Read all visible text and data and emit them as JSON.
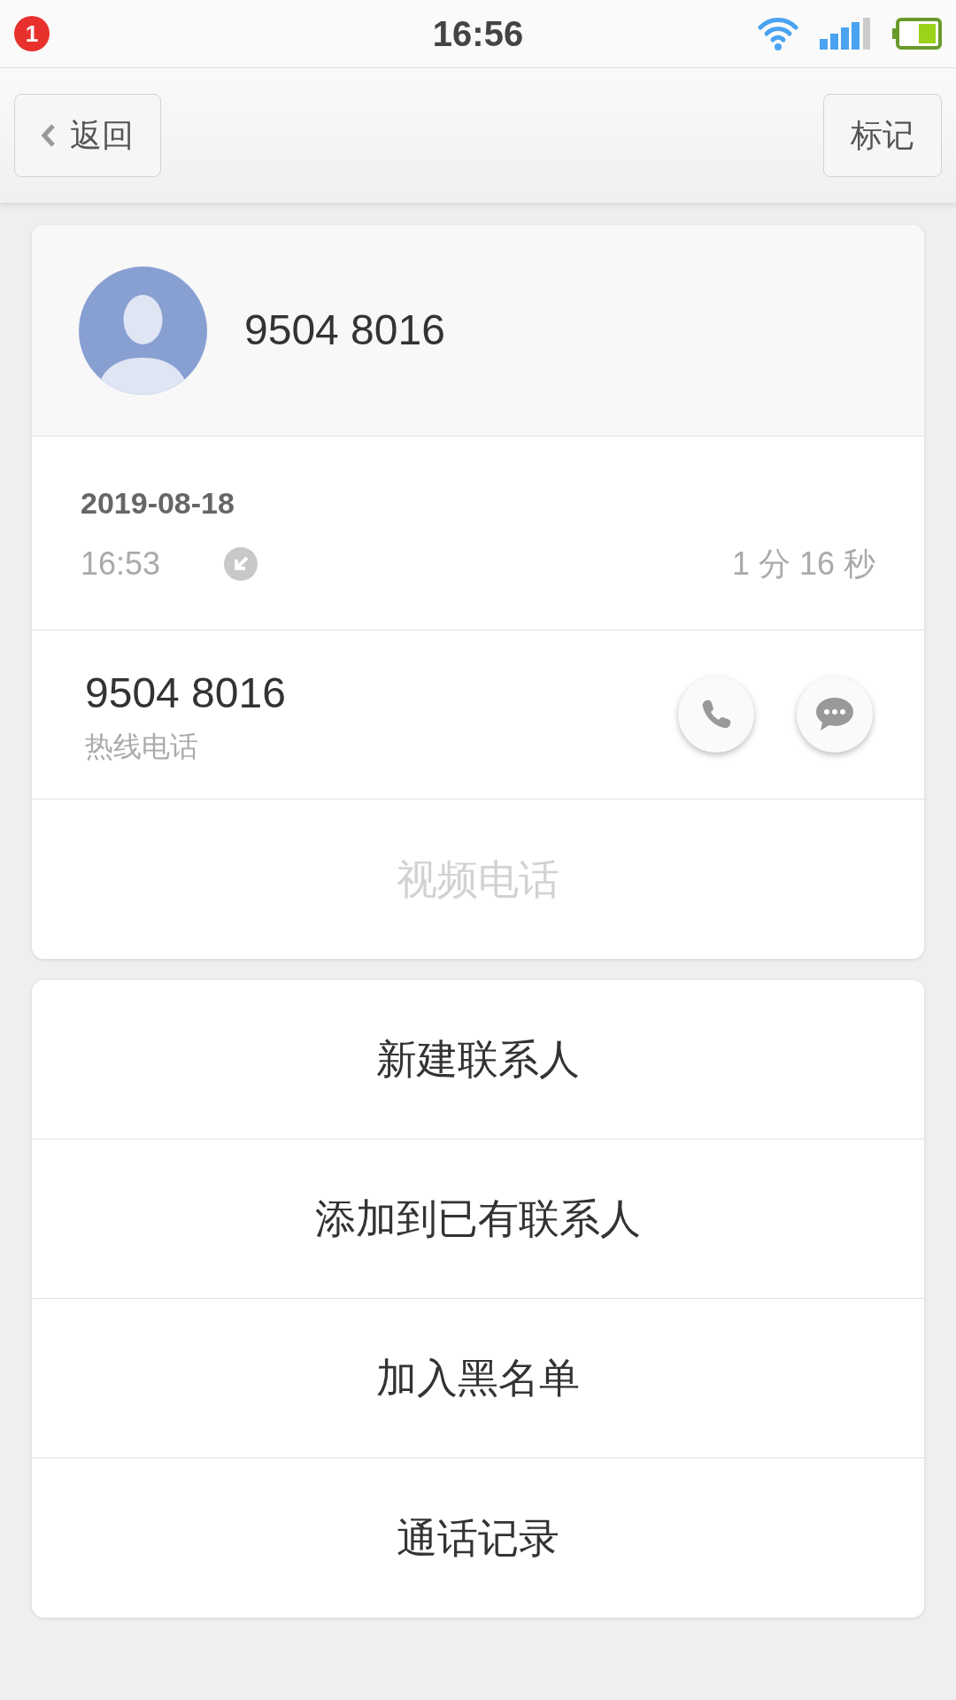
{
  "status_bar": {
    "notification_count": "1",
    "time": "16:56"
  },
  "nav": {
    "back": "返回",
    "mark": "标记"
  },
  "contact": {
    "name": "9504 8016"
  },
  "call": {
    "date": "2019-08-18",
    "time": "16:53",
    "incoming": true,
    "duration": "1 分 16 秒"
  },
  "number": {
    "value": "9504 8016",
    "label": "热线电话"
  },
  "video_call": {
    "label": "视频电话",
    "disabled": true
  },
  "actions": [
    {
      "label": "新建联系人"
    },
    {
      "label": "添加到已有联系人"
    },
    {
      "label": "加入黑名单"
    },
    {
      "label": "通话记录"
    }
  ]
}
